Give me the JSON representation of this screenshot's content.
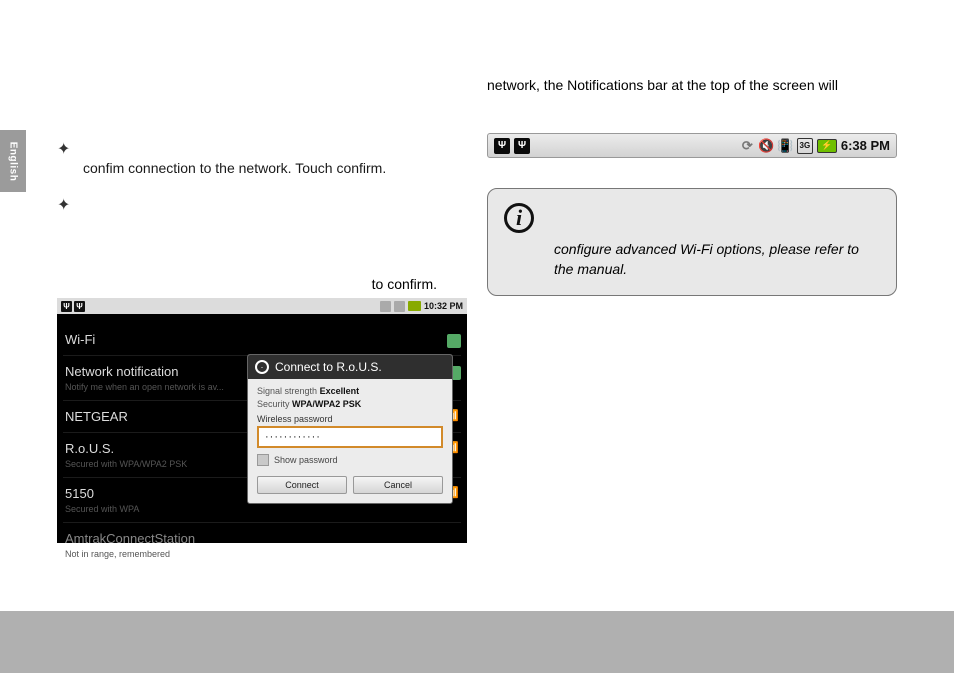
{
  "sideTab": "English",
  "left": {
    "bullet1": "confim connection to the network. Touch confirm.",
    "bullet2": "",
    "tail": "to confirm."
  },
  "screenshot": {
    "statusTime": "10:32 PM",
    "rows": {
      "wifi": "Wi-Fi",
      "notif": "Network notification",
      "notifSub": "Notify me when an open network is av...",
      "netgear": "NETGEAR",
      "rous": "R.o.U.S.",
      "rousSub": "Secured with WPA/WPA2 PSK",
      "n5150": "5150",
      "n5150Sub": "Secured with WPA",
      "amtrak": "AmtrakConnectStation",
      "amtrakSub": "Not in range, remembered"
    },
    "dialog": {
      "title": "Connect to R.o.U.S.",
      "signalK": "Signal strength",
      "signalV": "Excellent",
      "secK": "Security",
      "secV": "WPA/WPA2 PSK",
      "pwLabel": "Wireless password",
      "pwValue": "············",
      "showPw": "Show password",
      "connect": "Connect",
      "cancel": "Cancel"
    }
  },
  "right": {
    "intro": "network, the Notifications bar at the top of the screen will",
    "status": {
      "time": "6:38 PM"
    },
    "info": "configure advanced Wi-Fi options, please refer to the manual."
  }
}
